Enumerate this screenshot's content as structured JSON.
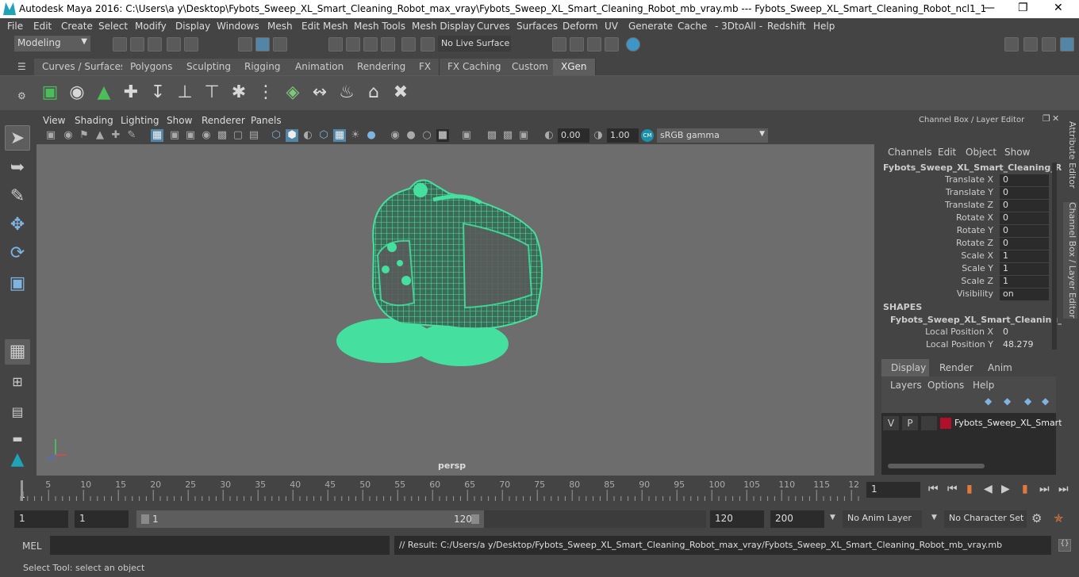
{
  "app_title": "Autodesk Maya 2016: C:\\Users\\a y\\Desktop\\Fybots_Sweep_XL_Smart_Cleaning_Robot_max_vray\\Fybots_Sweep_XL_Smart_Cleaning_Robot_mb_vray.mb   ---   Fybots_Sweep_XL_Smart_Cleaning_Robot_ncl1_1",
  "menu": [
    "File",
    "Edit",
    "Create",
    "Select",
    "Modify",
    "Display",
    "Windows",
    "Mesh",
    "Edit Mesh",
    "Mesh Tools",
    "Mesh Display",
    "Curves",
    "Surfaces",
    "Deform",
    "UV",
    "Generate",
    "Cache",
    "- 3DtoAll -",
    "Redshift",
    "Help"
  ],
  "mode_select": "Modeling",
  "live_surface": "No Live Surface",
  "shelf_tabs": [
    "Curves / Surfaces",
    "Polygons",
    "Sculpting",
    "Rigging",
    "Animation",
    "Rendering",
    "FX",
    "FX Caching",
    "Custom",
    "XGen"
  ],
  "active_shelf": "XGen",
  "panel_menu": [
    "View",
    "Shading",
    "Lighting",
    "Show",
    "Renderer",
    "Panels"
  ],
  "panel_toolbar": {
    "exposure": "0.00",
    "gamma": "1.00",
    "color_space": "sRGB gamma"
  },
  "viewport_label": "persp",
  "channel_box": {
    "header": "Channel Box / Layer Editor",
    "menu": [
      "Channels",
      "Edit",
      "Object",
      "Show"
    ],
    "object_name": "Fybots_Sweep_XL_Smart_Cleaning_Ro...",
    "attributes": [
      {
        "label": "Translate X",
        "value": "0"
      },
      {
        "label": "Translate Y",
        "value": "0"
      },
      {
        "label": "Translate Z",
        "value": "0"
      },
      {
        "label": "Rotate X",
        "value": "0"
      },
      {
        "label": "Rotate Y",
        "value": "0"
      },
      {
        "label": "Rotate Z",
        "value": "0"
      },
      {
        "label": "Scale X",
        "value": "1"
      },
      {
        "label": "Scale Y",
        "value": "1"
      },
      {
        "label": "Scale Z",
        "value": "1"
      },
      {
        "label": "Visibility",
        "value": "on"
      }
    ],
    "shapes_header": "SHAPES",
    "shape_name": "Fybots_Sweep_XL_Smart_Cleaning_...",
    "shape_attributes": [
      {
        "label": "Local Position X",
        "value": "0"
      },
      {
        "label": "Local Position Y",
        "value": "48.279"
      }
    ]
  },
  "layer_editor": {
    "tabs": [
      "Display",
      "Render",
      "Anim"
    ],
    "active_tab": "Display",
    "menu": [
      "Layers",
      "Options",
      "Help"
    ],
    "layer": {
      "v": "V",
      "p": "P",
      "name": "Fybots_Sweep_XL_Smart_",
      "color": "#b0102a"
    }
  },
  "side_tabs": [
    "Attribute Editor",
    "Channel Box / Layer Editor"
  ],
  "timeline_ticks": [
    "5",
    "10",
    "15",
    "20",
    "25",
    "30",
    "35",
    "40",
    "45",
    "50",
    "55",
    "60",
    "65",
    "70",
    "75",
    "80",
    "85",
    "90",
    "95",
    "100",
    "105",
    "110",
    "115",
    "12"
  ],
  "timeline_start": "1",
  "current_frame": "1",
  "range": {
    "start": "1",
    "playback_start": "1",
    "slider_start": "1",
    "slider_end": "120",
    "playback_end": "120",
    "end": "200"
  },
  "anim_layer": "No Anim Layer",
  "character_set": "No Character Set",
  "mel_label": "MEL",
  "result_text": "// Result: C:/Users/a y/Desktop/Fybots_Sweep_XL_Smart_Cleaning_Robot_max_vray/Fybots_Sweep_XL_Smart_Cleaning_Robot_mb_vray.mb",
  "help_line": "Select Tool: select an object",
  "colors": {
    "wireframe": "#45e0a0",
    "viewport_bg": "#6d6d6d",
    "accent": "#5285a6"
  }
}
